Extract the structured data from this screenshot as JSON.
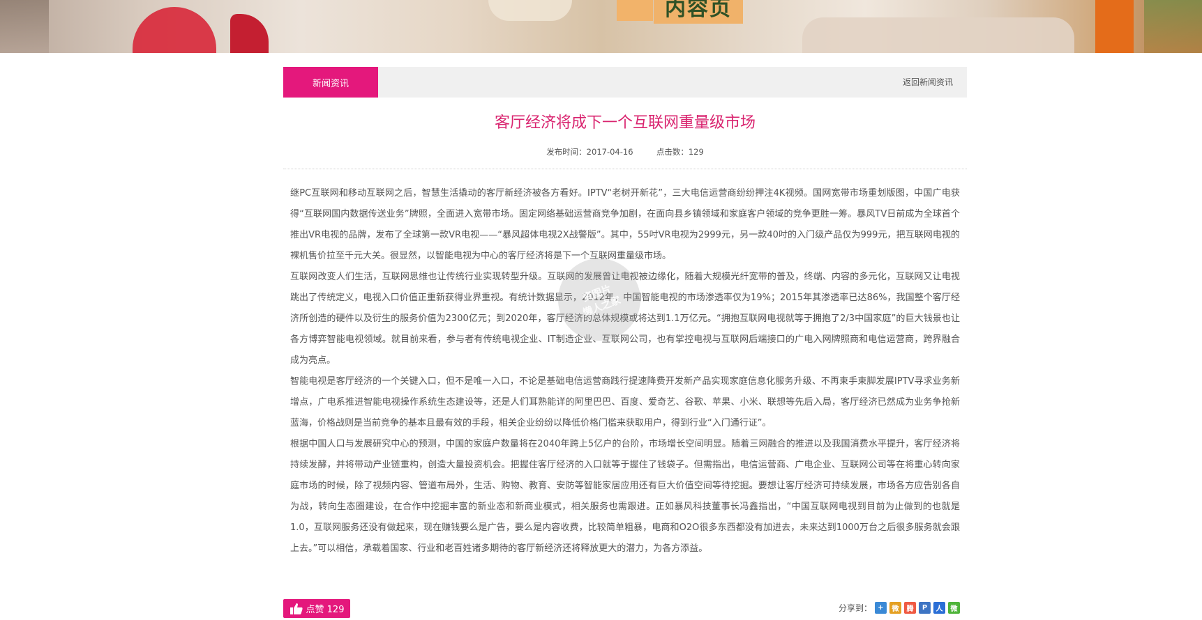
{
  "banner": {
    "title": "内容页"
  },
  "tabs": {
    "active": "新闻资讯",
    "back": "返回新闻资讯"
  },
  "article": {
    "title": "客厅经济将成下一个互联网重量级市场",
    "publish_label": "发布时间：2017-04-16",
    "clicks_label": "点击数：129",
    "paragraphs": [
      "继PC互联网和移动互联网之后，智慧生活撬动的客厅新经济被各方看好。IPTV“老树开新花”，三大电信运营商纷纷押注4K视频。国网宽带市场重划版图，中国广电获得“互联网国内数据传送业务”牌照，全面进入宽带市场。固定网络基础运营商竞争加剧，在面向县乡镇领域和家庭客户领域的竞争更胜一筹。暴风TV日前成为全球首个推出VR电视的品牌，发布了全球第一款VR电视——“暴风超体电视2X战警版”。其中，55吋VR电视为2999元，另一款40吋的入门级产品仅为999元，把互联网电视的裸机售价拉至千元大关。很显然，以智能电视为中心的客厅经济将是下一个互联网重量级市场。",
      "互联网改变人们生活，互联网思维也让传统行业实现转型升级。互联网的发展曾让电视被边缘化，随着大规模光纤宽带的普及，终端、内容的多元化，互联网又让电视跳出了传统定义，电视入口价值正重新获得业界重视。有统计数据显示，2012年，中国智能电视的市场渗透率仅为19%；2015年其渗透率已达86%，我国整个客厅经济所创造的硬件以及衍生的服务价值为2300亿元；到2020年，客厅经济的总体规模或将达到1.1万亿元。“拥抱互联网电视就等于拥抱了2/3中国家庭”的巨大钱景也让各方博弈智能电视领域。就目前来看，参与者有传统电视企业、IT制造企业、互联网公司，也有掌控电视与互联网后端接口的广电入网牌照商和电信运营商，跨界融合成为亮点。",
      "智能电视是客厅经济的一个关键入口，但不是唯一入口，不论是基础电信运营商践行提速降费开发新产品实现家庭信息化服务升级、不再束手束脚发展IPTV寻求业务新增点，广电系推进智能电视操作系统生态建设等，还是人们耳熟能详的阿里巴巴、百度、爱奇艺、谷歌、苹果、小米、联想等先后入局，客厅经济已然成为业务争抢新蓝海，价格战则是当前竞争的基本且最有效的手段，相关企业纷纷以降低价格门槛来获取用户，得到行业“入门通行证”。",
      "根据中国人口与发展研究中心的预测，中国的家庭户数量将在2040年跨上5亿户的台阶，市场增长空间明显。随着三网融合的推进以及我国消费水平提升，客厅经济将持续发酵，并将带动产业链重构，创造大量投资机会。把握住客厅经济的入口就等于握住了钱袋子。但需指出，电信运营商、广电企业、互联网公司等在将重心转向家庭市场的时候，除了视频内容、管道布局外，生活、购物、教育、安防等智能家居应用还有巨大价值空间等待挖掘。要想让客厅经济可持续发展，市场各方应告别各自为战，转向生态圈建设，在合作中挖掘丰富的新业态和新商业模式，相关服务也需跟进。正如暴风科技董事长冯鑫指出，“中国互联网电视到目前为止做到的也就是1.0，互联网服务还没有做起来，现在赚钱要么是广告，要么是内容收费，比较简单粗暴，电商和O2O很多东西都没有加进去，未来达到1000万台之后很多服务就会跟上去。”可以相信，承载着国家、行业和老百姓诸多期待的客厅新经济还将释放更大的潜力，为各方添益。"
    ]
  },
  "watermark": {
    "line1": "资图片",
    "line2": "懒人之家"
  },
  "like": {
    "label": "点赞 129"
  },
  "share": {
    "label": "分享到：",
    "icons": [
      {
        "name": "qzone-icon",
        "glyph": "+",
        "color": "#3a89d6"
      },
      {
        "name": "weibo-icon",
        "glyph": "微",
        "color": "#e4a023"
      },
      {
        "name": "tencent-weibo-icon",
        "glyph": "腾",
        "color": "#ef5a43"
      },
      {
        "name": "renren-icon",
        "glyph": "P",
        "color": "#3d74c3"
      },
      {
        "name": "baidu-icon",
        "glyph": "人",
        "color": "#2b6fd6"
      },
      {
        "name": "wechat-icon",
        "glyph": "微",
        "color": "#4fb43a"
      }
    ]
  }
}
